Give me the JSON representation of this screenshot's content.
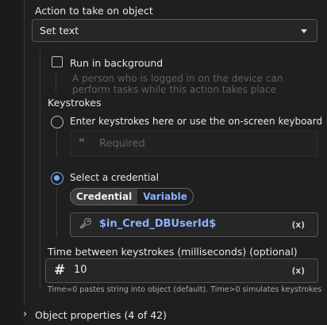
{
  "action": {
    "label": "Action to take on object",
    "value": "Set text"
  },
  "run_background": {
    "label": "Run in background",
    "checked": false,
    "help": "A person who is logged in on the device can perform tasks while this action takes place"
  },
  "keystrokes": {
    "heading": "Keystrokes",
    "option_enter": "Enter keystrokes here or use the on-screen keyboard",
    "input_placeholder": "Required",
    "option_credential": "Select a credential",
    "selected": "credential",
    "tabs": [
      "Credential",
      "Variable"
    ],
    "active_tab": "Credential",
    "credential_value": "$in_Cred_DBUserId$",
    "clear_label": "(x)"
  },
  "delay": {
    "label": "Time between keystrokes (milliseconds) (optional)",
    "value": "10",
    "clear_label": "(x)",
    "help": "Time=0 pastes string into object (default). Time>0 simulates keystrokes"
  },
  "object_properties": {
    "label": "Object properties (4 of 42)"
  },
  "colors": {
    "background": "#1f1f1f",
    "accent": "#7aa7ff",
    "link": "#8ab1ff"
  }
}
